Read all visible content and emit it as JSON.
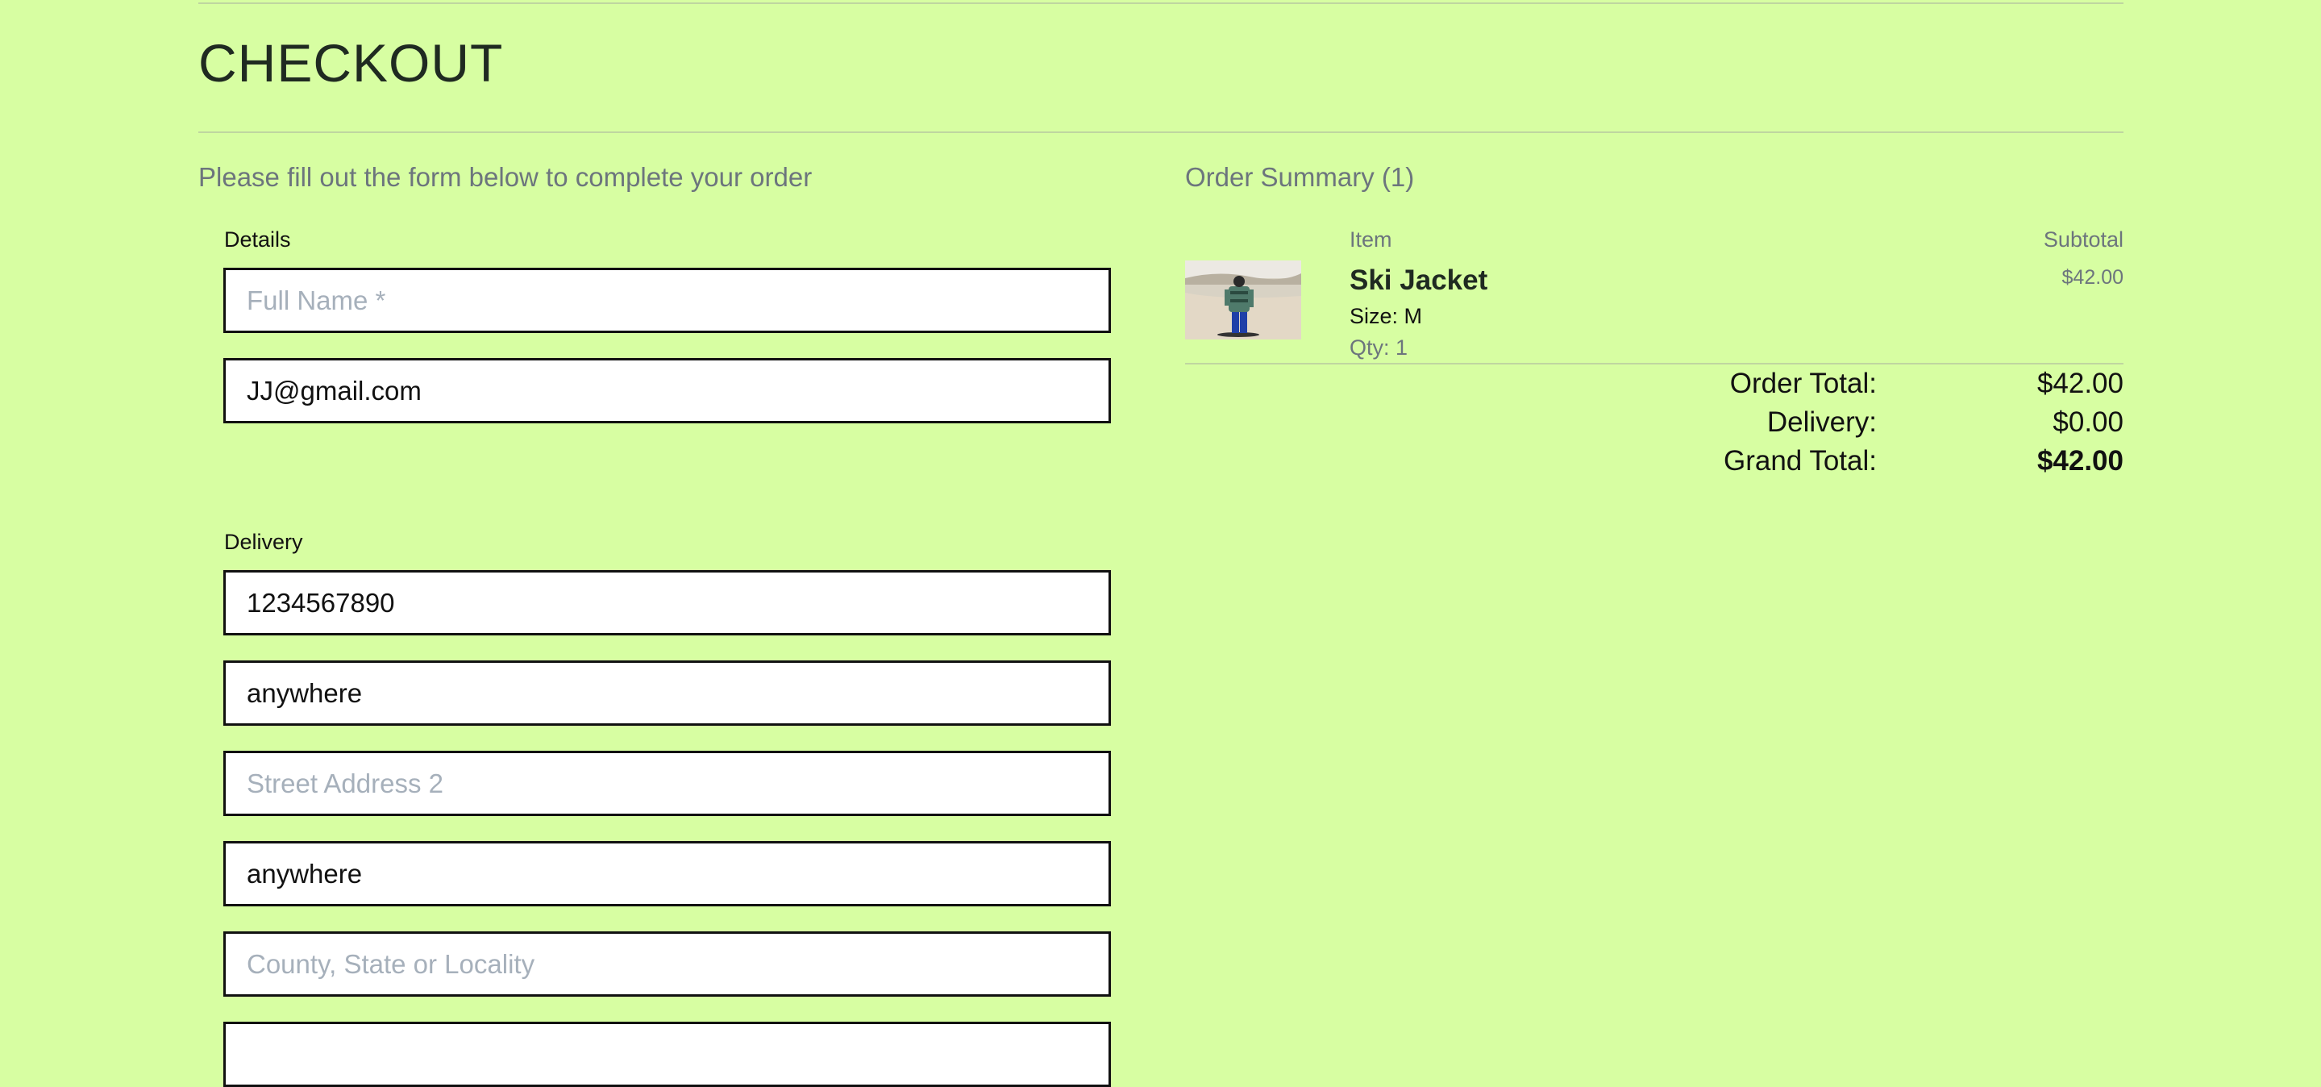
{
  "page": {
    "title": "CHECKOUT"
  },
  "form": {
    "intro": "Please fill out the form below to complete your order",
    "details_label": "Details",
    "full_name": {
      "value": "",
      "placeholder": "Full Name *"
    },
    "email": {
      "value": "JJ@gmail.com"
    },
    "delivery_label": "Delivery",
    "phone": {
      "value": "1234567890"
    },
    "street1": {
      "value": "anywhere"
    },
    "street2": {
      "value": "",
      "placeholder": "Street Address 2"
    },
    "town": {
      "value": "anywhere"
    },
    "county": {
      "value": "",
      "placeholder": "County, State or Locality"
    }
  },
  "summary": {
    "title": "Order Summary (1)",
    "col_item": "Item",
    "col_subtotal": "Subtotal",
    "items": [
      {
        "name": "Ski Jacket",
        "size": "Size: M",
        "qty": "Qty: 1",
        "subtotal": "$42.00",
        "image": "skier-photo"
      }
    ],
    "order_total_label": "Order Total:",
    "order_total": "$42.00",
    "delivery_label": "Delivery:",
    "delivery": "$0.00",
    "grand_total_label": "Grand Total:",
    "grand_total": "$42.00"
  },
  "colors": {
    "background": "#d7fea2",
    "text": "#1f2a21",
    "muted": "#6c757d"
  }
}
